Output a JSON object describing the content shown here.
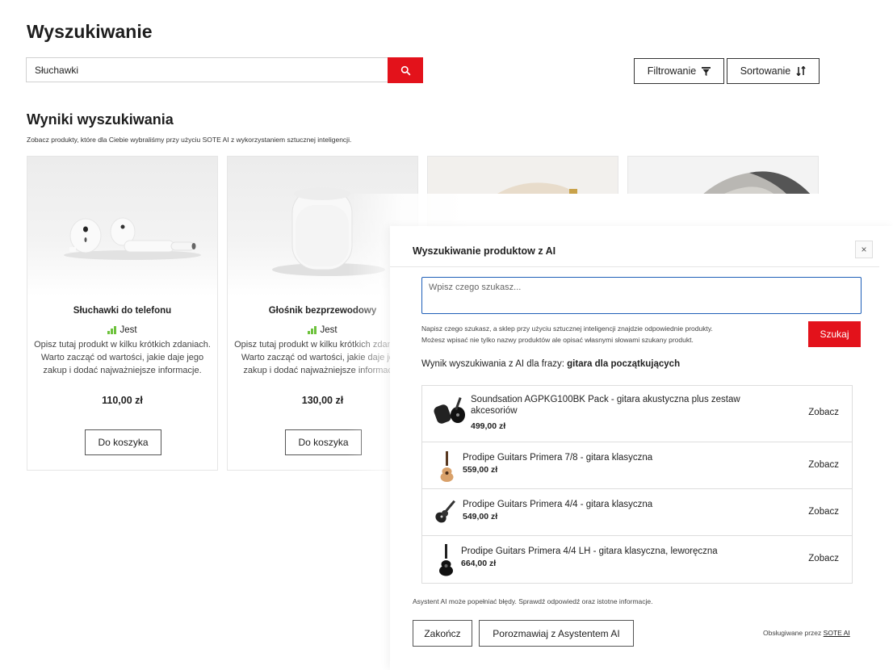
{
  "page": {
    "title": "Wyszukiwanie"
  },
  "search": {
    "value": "Słuchawki",
    "button_icon": "search-icon"
  },
  "toolbar": {
    "filter_label": "Filtrowanie",
    "filter_icon": "filter-icon",
    "sort_label": "Sortowanie",
    "sort_icon": "sort-icon"
  },
  "results": {
    "title": "Wyniki wyszukiwania",
    "subtitle": "Zobacz produkty, które dla Ciebie wybraliśmy przy użyciu SOTE AI z wykorzystaniem sztucznej inteligencji."
  },
  "products": [
    {
      "name": "Słuchawki do telefonu",
      "stock": "Jest",
      "description": "Opisz tutaj produkt w kilku krótkich zdaniach. Warto zacząć od wartości, jakie daje jego zakup i dodać najważniejsze informacje.",
      "price": "110,00 zł",
      "cart_label": "Do koszyka"
    },
    {
      "name": "Głośnik bezprzewodowy",
      "stock": "Jest",
      "description": "Opisz tutaj produkt w kilku krótkich zdaniach. Warto zacząć od wartości, jakie daje jego zakup i dodać najważniejsze informacje.",
      "price": "130,00 zł",
      "cart_label": "Do koszyka"
    }
  ],
  "colors": {
    "accent": "#e3121b",
    "stock": "#6dc23c",
    "input_focus": "#1f5fb8"
  },
  "ai_modal": {
    "title": "Wyszukiwanie produktow z AI",
    "close_label": "×",
    "input_placeholder": "Wpisz czego szukasz...",
    "hint_line1": "Napisz czego szukasz, a sklep przy użyciu sztucznej inteligencji znajdzie odpowiednie produkty.",
    "hint_line2": "Możesz wpisać nie tylko nazwy produktów ale opisać własnymi słowami szukany produkt.",
    "search_button": "Szukaj",
    "result_prefix": "Wynik wyszukiwania z AI dla frazy:",
    "result_phrase": "gitara dla początkujących",
    "items": [
      {
        "name": "Soundsation AGPKG100BK Pack - gitara akustyczna plus zestaw akcesoriów",
        "price": "499,00 zł",
        "link": "Zobacz",
        "thumb_icon": "guitar-pack-icon"
      },
      {
        "name": "Prodipe Guitars Primera 7/8 - gitara klasyczna",
        "price": "559,00 zł",
        "link": "Zobacz",
        "thumb_icon": "classical-guitar-icon"
      },
      {
        "name": "Prodipe Guitars Primera 4/4 - gitara klasyczna",
        "price": "549,00 zł",
        "link": "Zobacz",
        "thumb_icon": "guitar-icon"
      },
      {
        "name": "Prodipe Guitars Primera 4/4 LH - gitara klasyczna, leworęczna",
        "price": "664,00 zł",
        "link": "Zobacz",
        "thumb_icon": "black-guitar-icon"
      }
    ],
    "disclaimer": "Asystent AI może popełniać błędy. Sprawdź odpowiedź oraz istotne informacje.",
    "end_button": "Zakończ",
    "chat_button": "Porozmawiaj z Asystentem AI",
    "powered_prefix": "Obsługiwane przez",
    "powered_link": "SOTE AI"
  }
}
